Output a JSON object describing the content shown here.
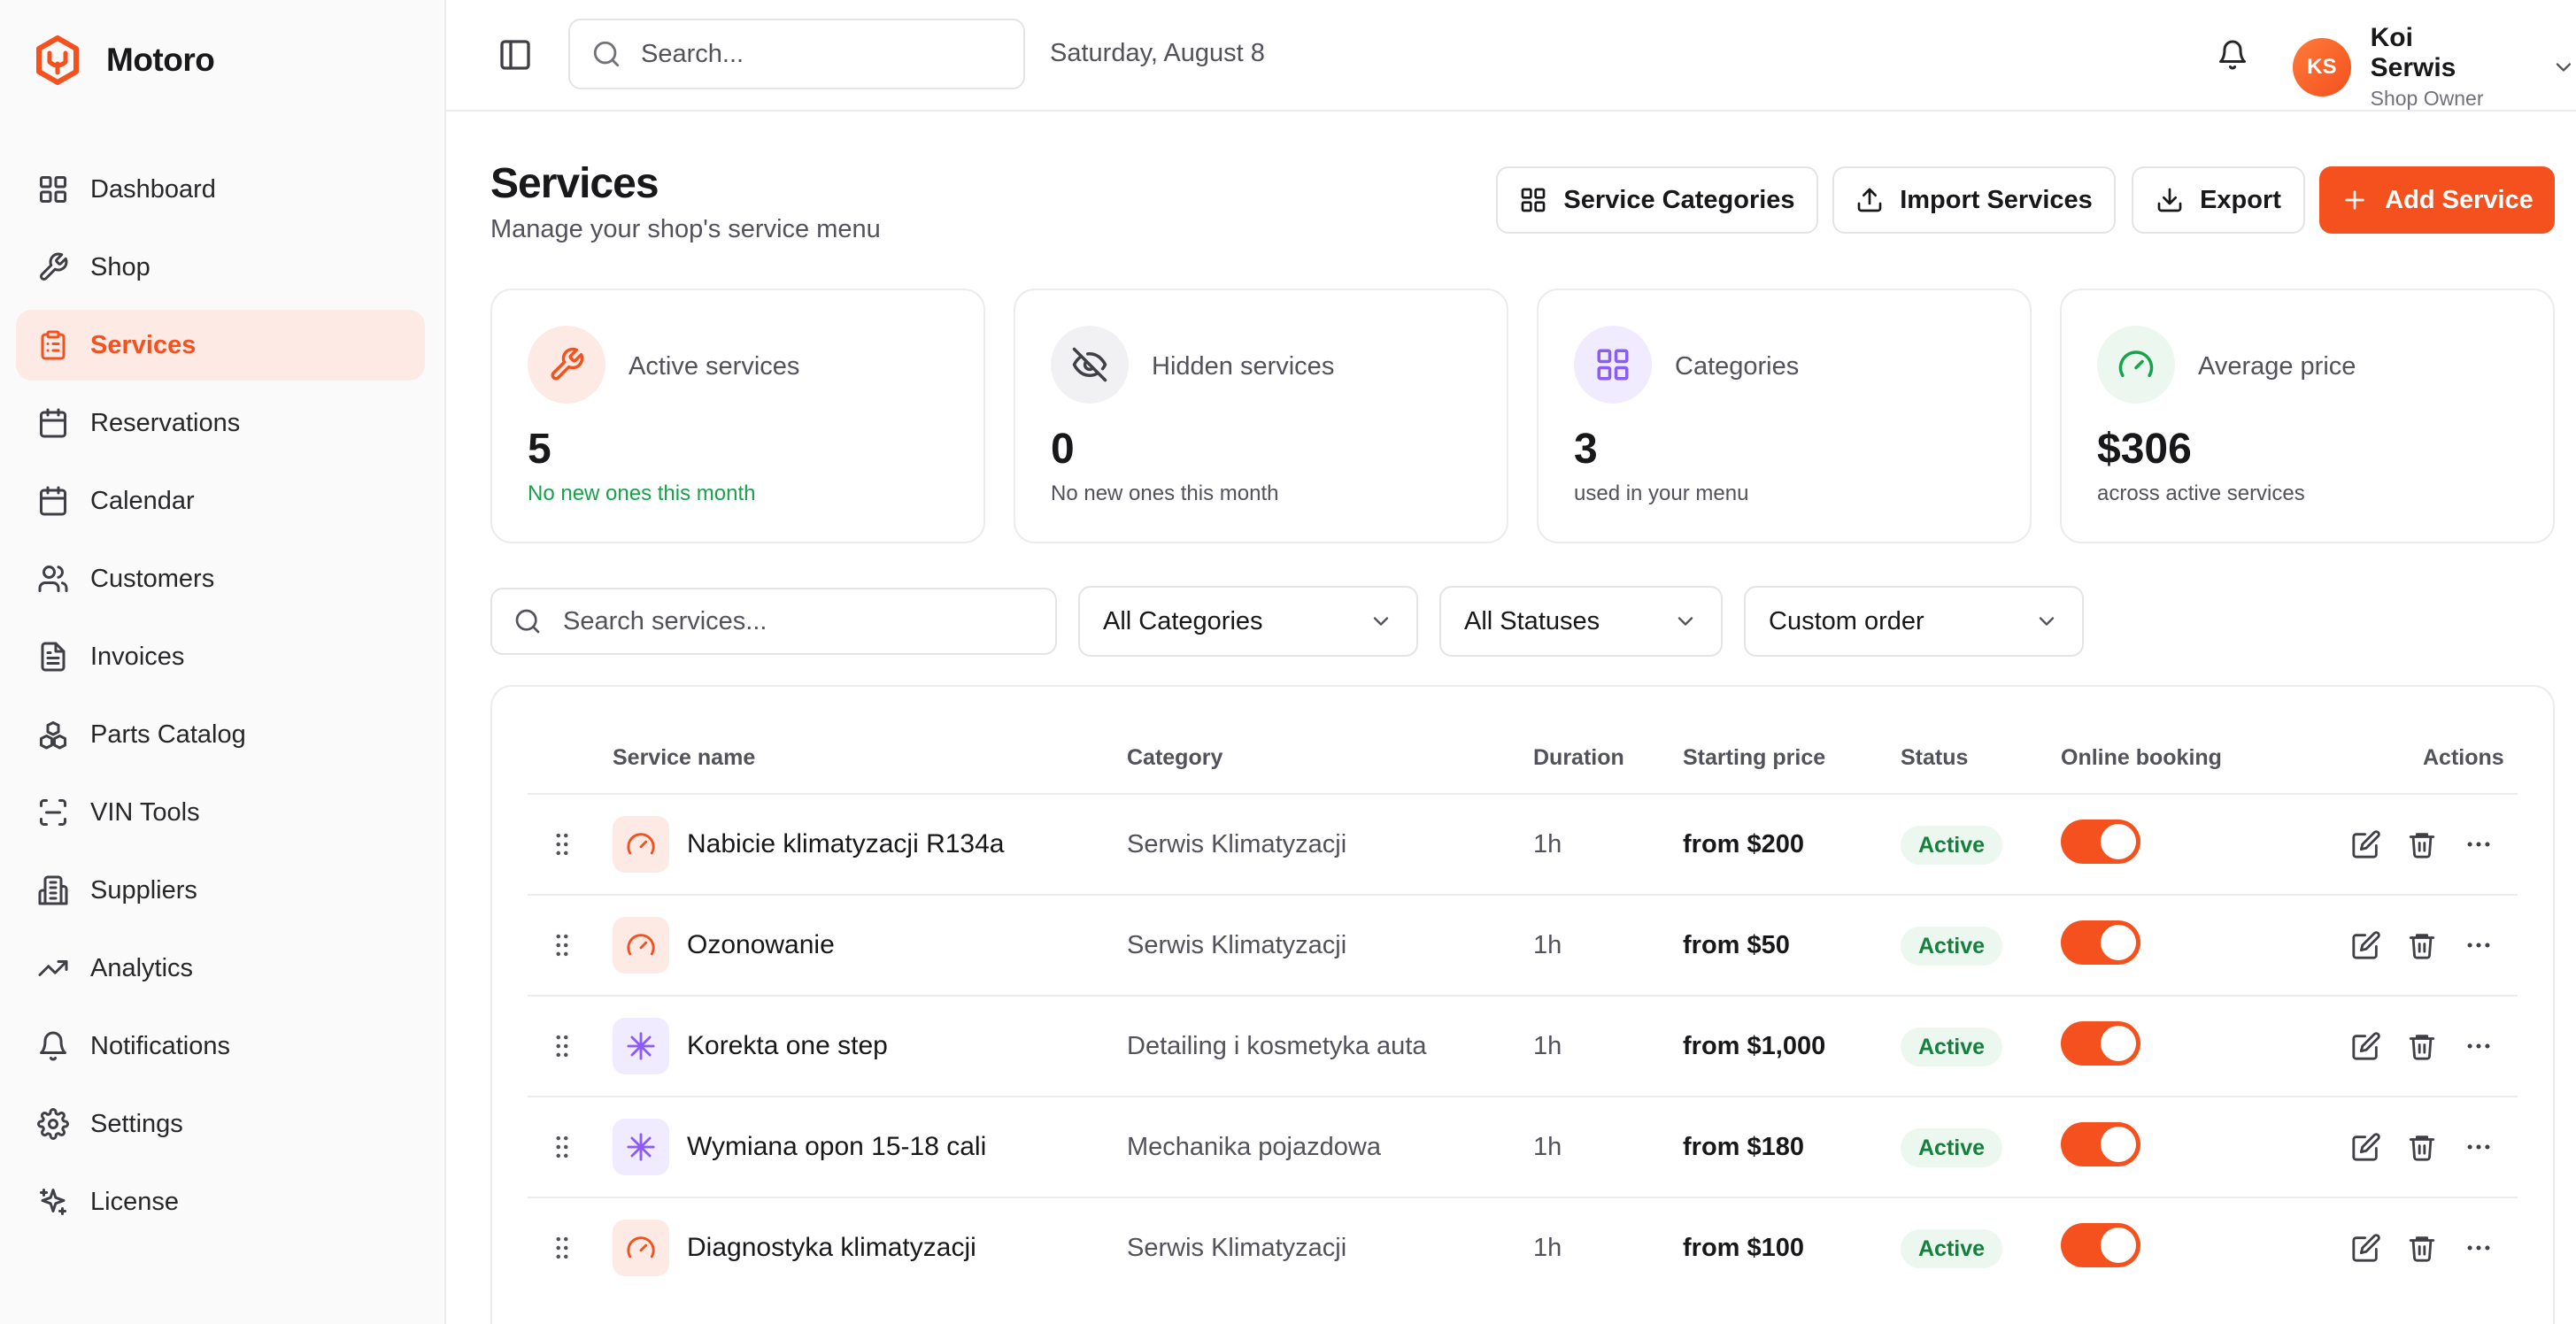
{
  "app": {
    "name": "Motoro",
    "logo_icon": "motoro-logo-icon"
  },
  "accent_color": "#f4511e",
  "sidebar": {
    "items": [
      {
        "label": "Dashboard",
        "icon": "dashboard-grid-icon"
      },
      {
        "label": "Shop",
        "icon": "wrench-icon"
      },
      {
        "label": "Services",
        "icon": "clipboard-list-icon",
        "active": true
      },
      {
        "label": "Reservations",
        "icon": "calendar-icon"
      },
      {
        "label": "Calendar",
        "icon": "calendar-icon"
      },
      {
        "label": "Customers",
        "icon": "users-icon"
      },
      {
        "label": "Invoices",
        "icon": "file-text-icon"
      },
      {
        "label": "Parts Catalog",
        "icon": "boxes-icon"
      },
      {
        "label": "VIN Tools",
        "icon": "scan-icon"
      },
      {
        "label": "Suppliers",
        "icon": "building-icon"
      },
      {
        "label": "Analytics",
        "icon": "trending-up-icon"
      },
      {
        "label": "Notifications",
        "icon": "bell-icon"
      },
      {
        "label": "Settings",
        "icon": "gear-icon"
      },
      {
        "label": "License",
        "icon": "sparkles-icon"
      }
    ]
  },
  "topbar": {
    "search_placeholder": "Search...",
    "date": "Saturday, August 8",
    "user": {
      "initials": "KS",
      "name": "Koi Serwis",
      "role": "Shop Owner"
    }
  },
  "page": {
    "title": "Services",
    "subtitle": "Manage your shop's service menu",
    "buttons": {
      "categories": "Service Categories",
      "import": "Import Services",
      "export": "Export",
      "add": "Add Service"
    }
  },
  "stats": [
    {
      "label": "Active services",
      "value": "5",
      "note": "No new ones this month",
      "icon": "wrench-icon"
    },
    {
      "label": "Hidden services",
      "value": "0",
      "note": "No new ones this month",
      "icon": "eye-off-icon"
    },
    {
      "label": "Categories",
      "value": "3",
      "note": "used in your menu",
      "icon": "grid-icon"
    },
    {
      "label": "Average price",
      "value": "$306",
      "note": "across active services",
      "icon": "gauge-icon"
    }
  ],
  "filters": {
    "search_placeholder": "Search services...",
    "category": "All Categories",
    "status": "All Statuses",
    "order": "Custom order"
  },
  "table": {
    "headers": {
      "name": "Service name",
      "category": "Category",
      "duration": "Duration",
      "price": "Starting price",
      "status": "Status",
      "online": "Online booking",
      "actions": "Actions"
    },
    "rows": [
      {
        "name": "Nabicie klimatyzacji R134a",
        "category": "Serwis Klimatyzacji",
        "duration": "1h",
        "price": "from $200",
        "status": "Active",
        "online_booking": true,
        "icon": "gauge-icon"
      },
      {
        "name": "Ozonowanie",
        "category": "Serwis Klimatyzacji",
        "duration": "1h",
        "price": "from $50",
        "status": "Active",
        "online_booking": true,
        "icon": "gauge-icon"
      },
      {
        "name": "Korekta one step",
        "category": "Detailing i kosmetyka auta",
        "duration": "1h",
        "price": "from $1,000",
        "status": "Active",
        "online_booking": true,
        "icon": "snowflake-icon"
      },
      {
        "name": "Wymiana opon 15-18 cali",
        "category": "Mechanika pojazdowa",
        "duration": "1h",
        "price": "from $180",
        "status": "Active",
        "online_booking": true,
        "icon": "snowflake-icon"
      },
      {
        "name": "Diagnostyka klimatyzacji",
        "category": "Serwis Klimatyzacji",
        "duration": "1h",
        "price": "from $100",
        "status": "Active",
        "online_booking": true,
        "icon": "gauge-icon"
      }
    ]
  }
}
